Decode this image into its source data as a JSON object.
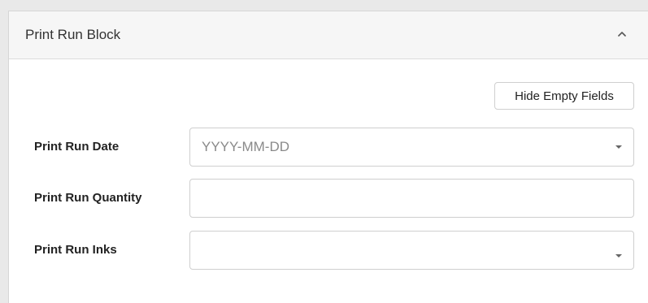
{
  "card": {
    "title": "Print Run Block",
    "collapse_icon": "chevron-up-icon"
  },
  "toolbar": {
    "hide_empty_label": "Hide Empty Fields"
  },
  "fields": [
    {
      "label": "Print Run Date",
      "type": "select",
      "value": "",
      "placeholder": "YYYY-MM-DD",
      "icon": "caret-down-icon"
    },
    {
      "label": "Print Run Quantity",
      "type": "text",
      "value": "",
      "placeholder": ""
    },
    {
      "label": "Print Run Inks",
      "type": "select",
      "value": "",
      "placeholder": "",
      "icon": "caret-down-icon"
    }
  ],
  "colors": {
    "header_bg": "#f6f6f6",
    "border": "#cfcfcf",
    "text": "#222222",
    "placeholder": "#8a8a8a"
  }
}
